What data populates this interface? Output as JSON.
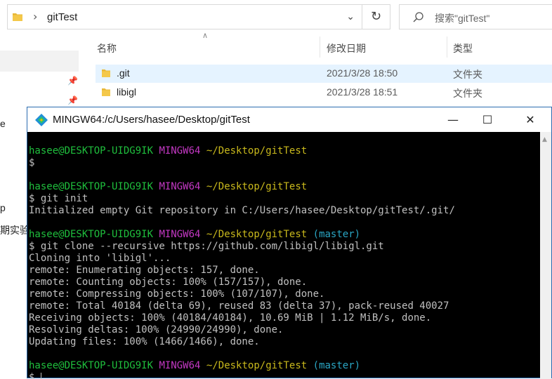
{
  "explorer": {
    "address": {
      "path": "gitTest",
      "separator": "›"
    },
    "search": {
      "placeholder": "搜索\"gitTest\""
    },
    "columns": {
      "name": "名称",
      "date": "修改日期",
      "type": "类型"
    },
    "files": [
      {
        "name": ".git",
        "date": "2021/3/28 18:50",
        "type": "文件夹"
      },
      {
        "name": "libigl",
        "date": "2021/3/28 18:51",
        "type": "文件夹"
      }
    ],
    "nav_fragments": [
      "e",
      "p",
      "期实验"
    ]
  },
  "terminal": {
    "title": "MINGW64:/c/Users/hasee/Desktop/gitTest",
    "buttons": {
      "minimize": "—",
      "maximize": "☐",
      "close": "✕"
    },
    "prompts": [
      {
        "user": "hasee@DESKTOP-UIDG9IK",
        "host": "MINGW64",
        "path": "~/Desktop/gitTest",
        "branch": ""
      },
      {
        "user": "hasee@DESKTOP-UIDG9IK",
        "host": "MINGW64",
        "path": "~/Desktop/gitTest",
        "branch": ""
      },
      {
        "user": "hasee@DESKTOP-UIDG9IK",
        "host": "MINGW64",
        "path": "~/Desktop/gitTest",
        "branch": "(master)"
      },
      {
        "user": "hasee@DESKTOP-UIDG9IK",
        "host": "MINGW64",
        "path": "~/Desktop/gitTest",
        "branch": "(master)"
      }
    ],
    "commands": [
      "$",
      "$ git init",
      "$ git clone --recursive https://github.com/libigl/libigl.git",
      "$ "
    ],
    "output_init": [
      "Initialized empty Git repository in C:/Users/hasee/Desktop/gitTest/.git/"
    ],
    "output_clone": [
      "Cloning into 'libigl'...",
      "remote: Enumerating objects: 157, done.",
      "remote: Counting objects: 100% (157/157), done.",
      "remote: Compressing objects: 100% (107/107), done.",
      "remote: Total 40184 (delta 69), reused 83 (delta 37), pack-reused 40027",
      "Receiving objects: 100% (40184/40184), 10.69 MiB | 1.12 MiB/s, done.",
      "Resolving deltas: 100% (24990/24990), done.",
      "Updating files: 100% (1466/1466), done."
    ]
  },
  "colors": {
    "user": "#1fbf3d",
    "host": "#c338c3",
    "path": "#c9b91c",
    "branch": "#2aa6c4",
    "folder": "#e8b737",
    "selection": "#e5f3ff"
  }
}
